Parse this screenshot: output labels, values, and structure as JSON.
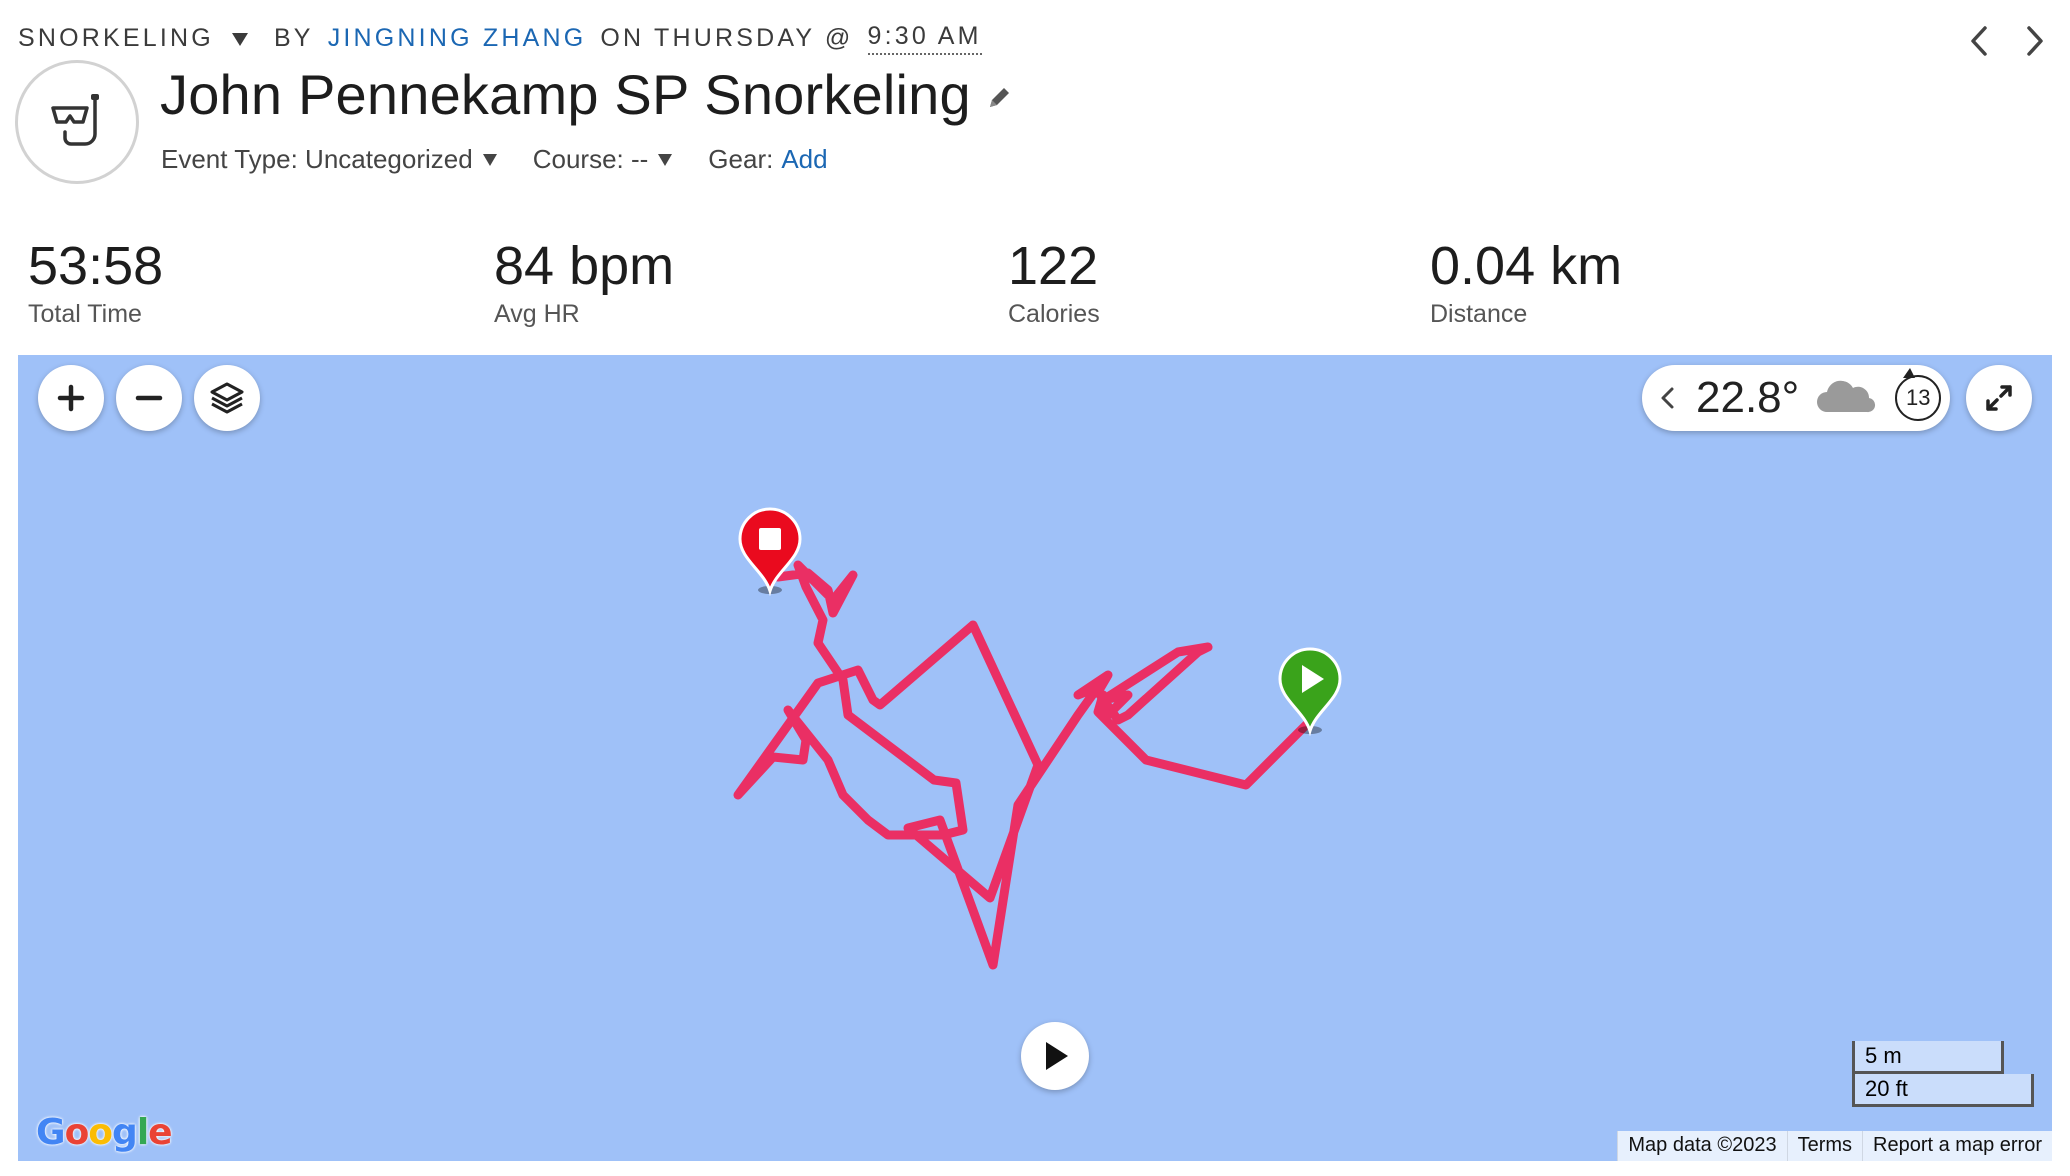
{
  "header": {
    "activity_type": "SNORKELING",
    "by_label": "BY",
    "author": "JINGNING ZHANG",
    "on_label": "ON THURSDAY @",
    "time": "9:30 AM"
  },
  "title": "John Pennekamp SP Snorkeling",
  "meta": {
    "event_type_label": "Event Type: Uncategorized",
    "course_label": "Course: --",
    "gear_label": "Gear:",
    "gear_link": "Add"
  },
  "stats": [
    {
      "value": "53:58",
      "label": "Total Time"
    },
    {
      "value": "84 bpm",
      "label": "Avg HR"
    },
    {
      "value": "122",
      "label": "Calories"
    },
    {
      "value": "0.04 km",
      "label": "Distance"
    }
  ],
  "map": {
    "weather_temp": "22.8°",
    "wind_speed": "13",
    "scale_m": "5 m",
    "scale_ft": "20 ft",
    "google": "Google",
    "map_data": "Map data ©2023",
    "terms": "Terms",
    "report": "Report a map error",
    "track_color": "#ea2f64",
    "water_color": "#9fc1f8",
    "start_marker_color": "#3aa31b",
    "end_marker_color": "#ea0a1e"
  },
  "icons": {
    "activity": "snorkel-mask-icon",
    "prev": "chevron-left-icon",
    "next": "chevron-right-icon",
    "edit": "pencil-icon",
    "zoom_in": "plus-icon",
    "zoom_out": "minus-icon",
    "layers": "layers-icon",
    "fullscreen": "fullscreen-icon",
    "weather": "cloud-icon",
    "wind": "wind-direction-icon",
    "play": "play-icon"
  }
}
